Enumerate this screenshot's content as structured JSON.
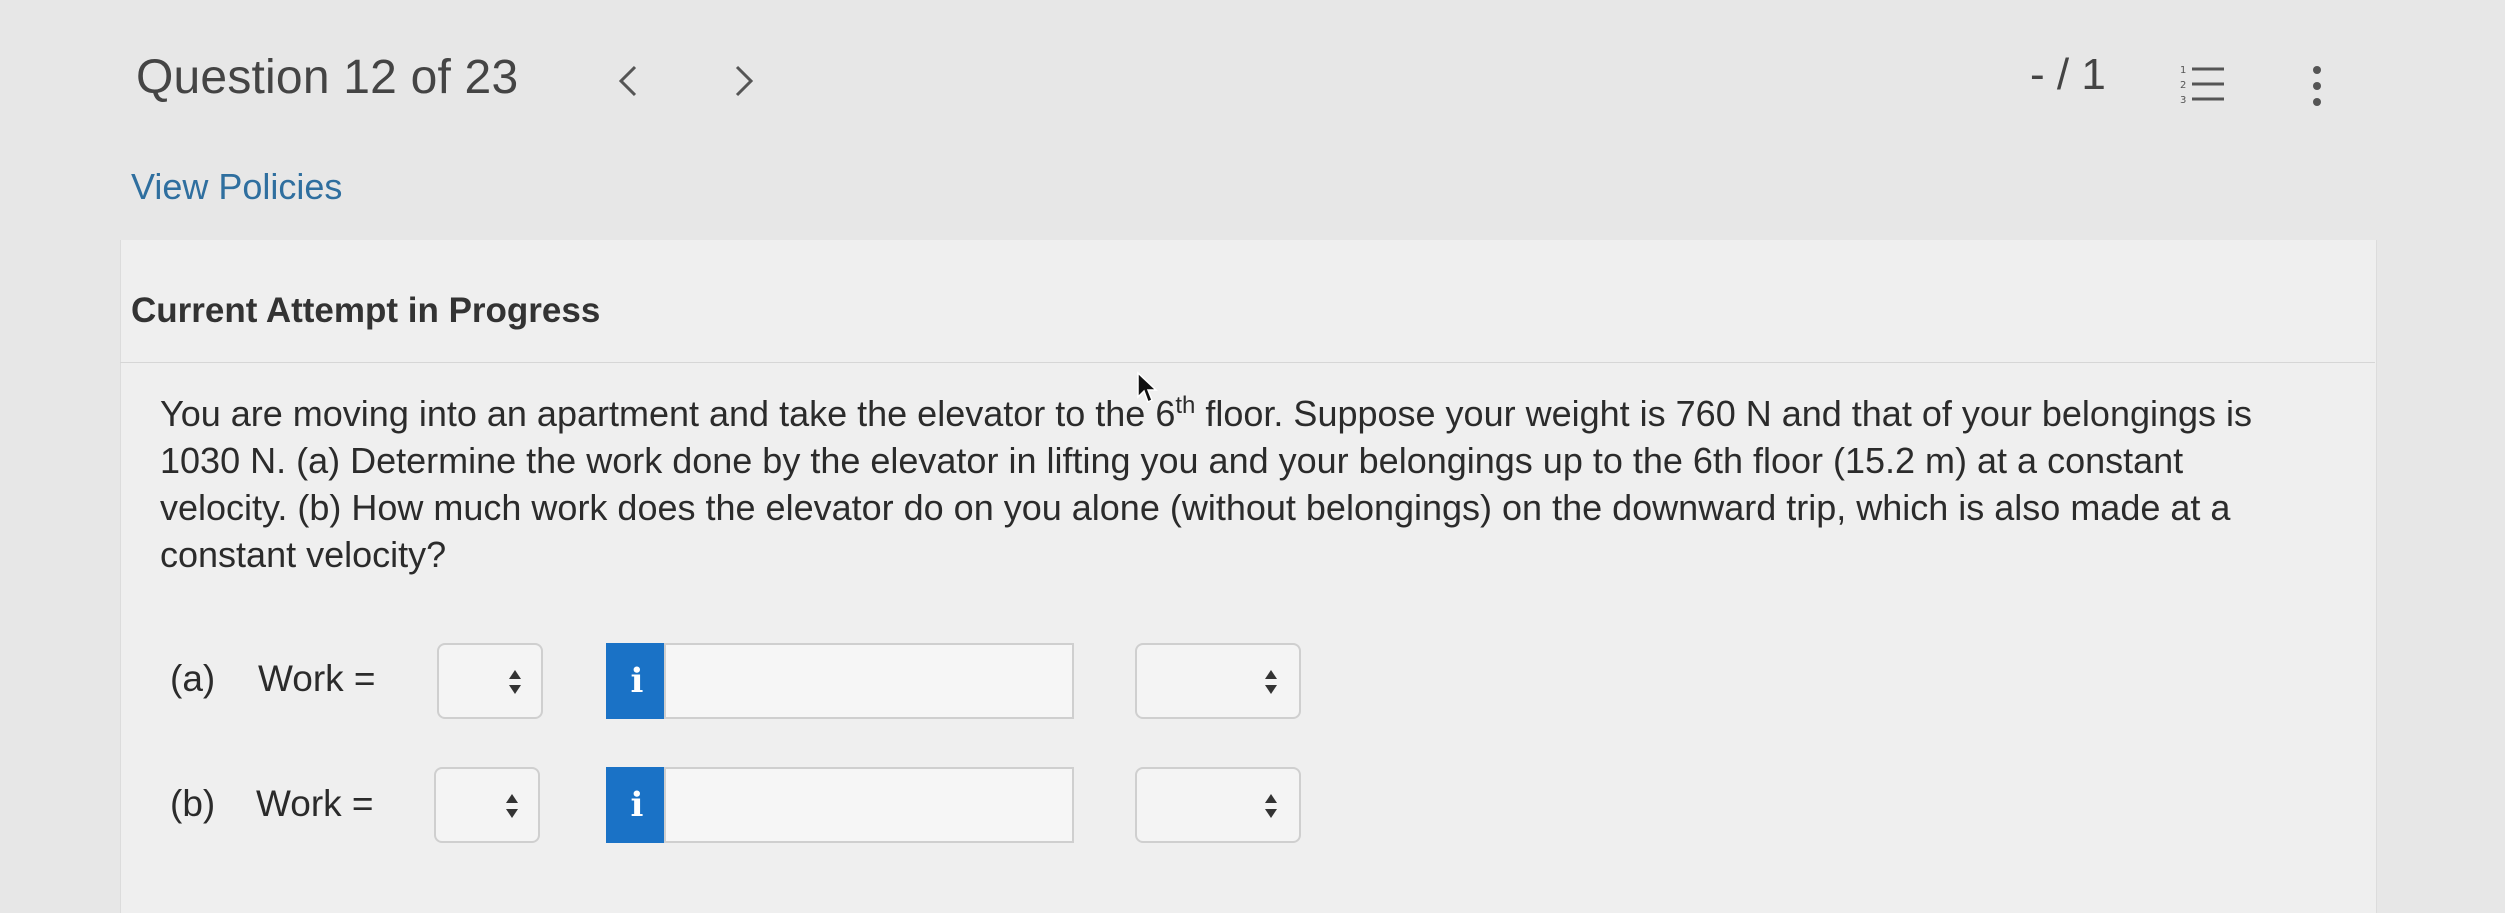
{
  "header": {
    "question_title": "Question 12 of 23",
    "score": "- / 1",
    "prev_icon": "chevron-left-icon",
    "next_icon": "chevron-right-icon",
    "list_icon": "numbered-list-icon",
    "menu_icon": "kebab-menu-icon"
  },
  "policies_link": "View Policies",
  "attempt_heading": "Current Attempt in Progress",
  "question": {
    "part1": "You are moving into an apartment and take the elevator to the 6",
    "sup": "th",
    "part2": " floor. Suppose your weight is 760 N and that of your belongings is 1030 N. (a) Determine the work done by the elevator in lifting you and your belongings up to the 6th floor (15.2 m) at a constant velocity. (b) How much work does the elevator do on you alone (without belongings) on the downward trip, which is also made at a constant velocity?"
  },
  "answers": [
    {
      "label": "(a)",
      "field_label": "Work =",
      "info_glyph": "i",
      "value": "",
      "sign": "",
      "unit": ""
    },
    {
      "label": "(b)",
      "field_label": "Work =",
      "info_glyph": "i",
      "value": "",
      "sign": "",
      "unit": ""
    }
  ],
  "colors": {
    "background": "#e7e7e7",
    "link": "#2f6f9f",
    "info_button": "#1a72c6"
  }
}
